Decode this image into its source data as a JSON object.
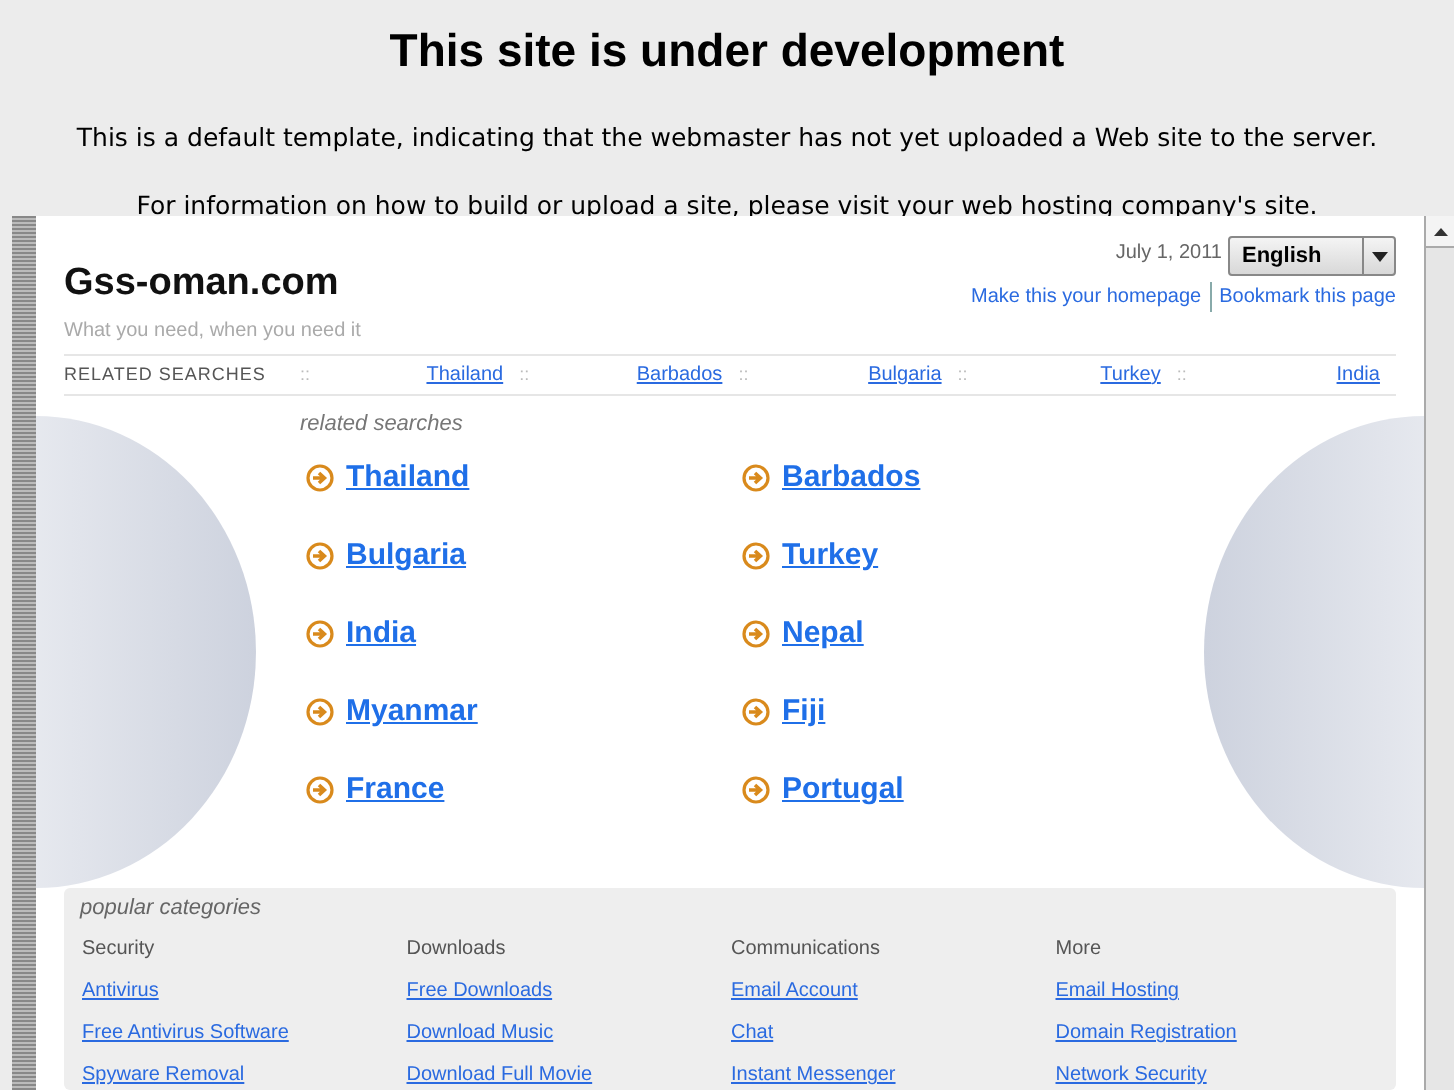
{
  "notice": {
    "title": "This site is under development",
    "lines": [
      "This is a default template, indicating that the webmaster has not yet uploaded a Web site to the server.",
      "For information on how to build or upload a site, please visit your web hosting company's site."
    ]
  },
  "site": {
    "name": "Gss-oman.com",
    "tagline": "What you need, when you need it",
    "date": "July 1, 2011",
    "language": "English",
    "links": [
      "Make this your homepage",
      "Bookmark this page"
    ]
  },
  "related_bar": {
    "label": "RELATED SEARCHES",
    "separator": "::",
    "items": [
      "Thailand",
      "Barbados",
      "Bulgaria",
      "Turkey",
      "India"
    ]
  },
  "related": {
    "heading": "related searches",
    "items": [
      "Thailand",
      "Barbados",
      "Bulgaria",
      "Turkey",
      "India",
      "Nepal",
      "Myanmar",
      "Fiji",
      "France",
      "Portugal"
    ]
  },
  "popular": {
    "heading": "popular categories",
    "columns": [
      {
        "title": "Security",
        "links": [
          "Antivirus",
          "Free Antivirus Software",
          "Spyware Removal"
        ]
      },
      {
        "title": "Downloads",
        "links": [
          "Free Downloads",
          "Download Music",
          "Download Full Movie"
        ]
      },
      {
        "title": "Communications",
        "links": [
          "Email Account",
          "Chat",
          "Instant Messenger"
        ]
      },
      {
        "title": "More",
        "links": [
          "Email Hosting",
          "Domain Registration",
          "Network Security"
        ]
      }
    ]
  }
}
